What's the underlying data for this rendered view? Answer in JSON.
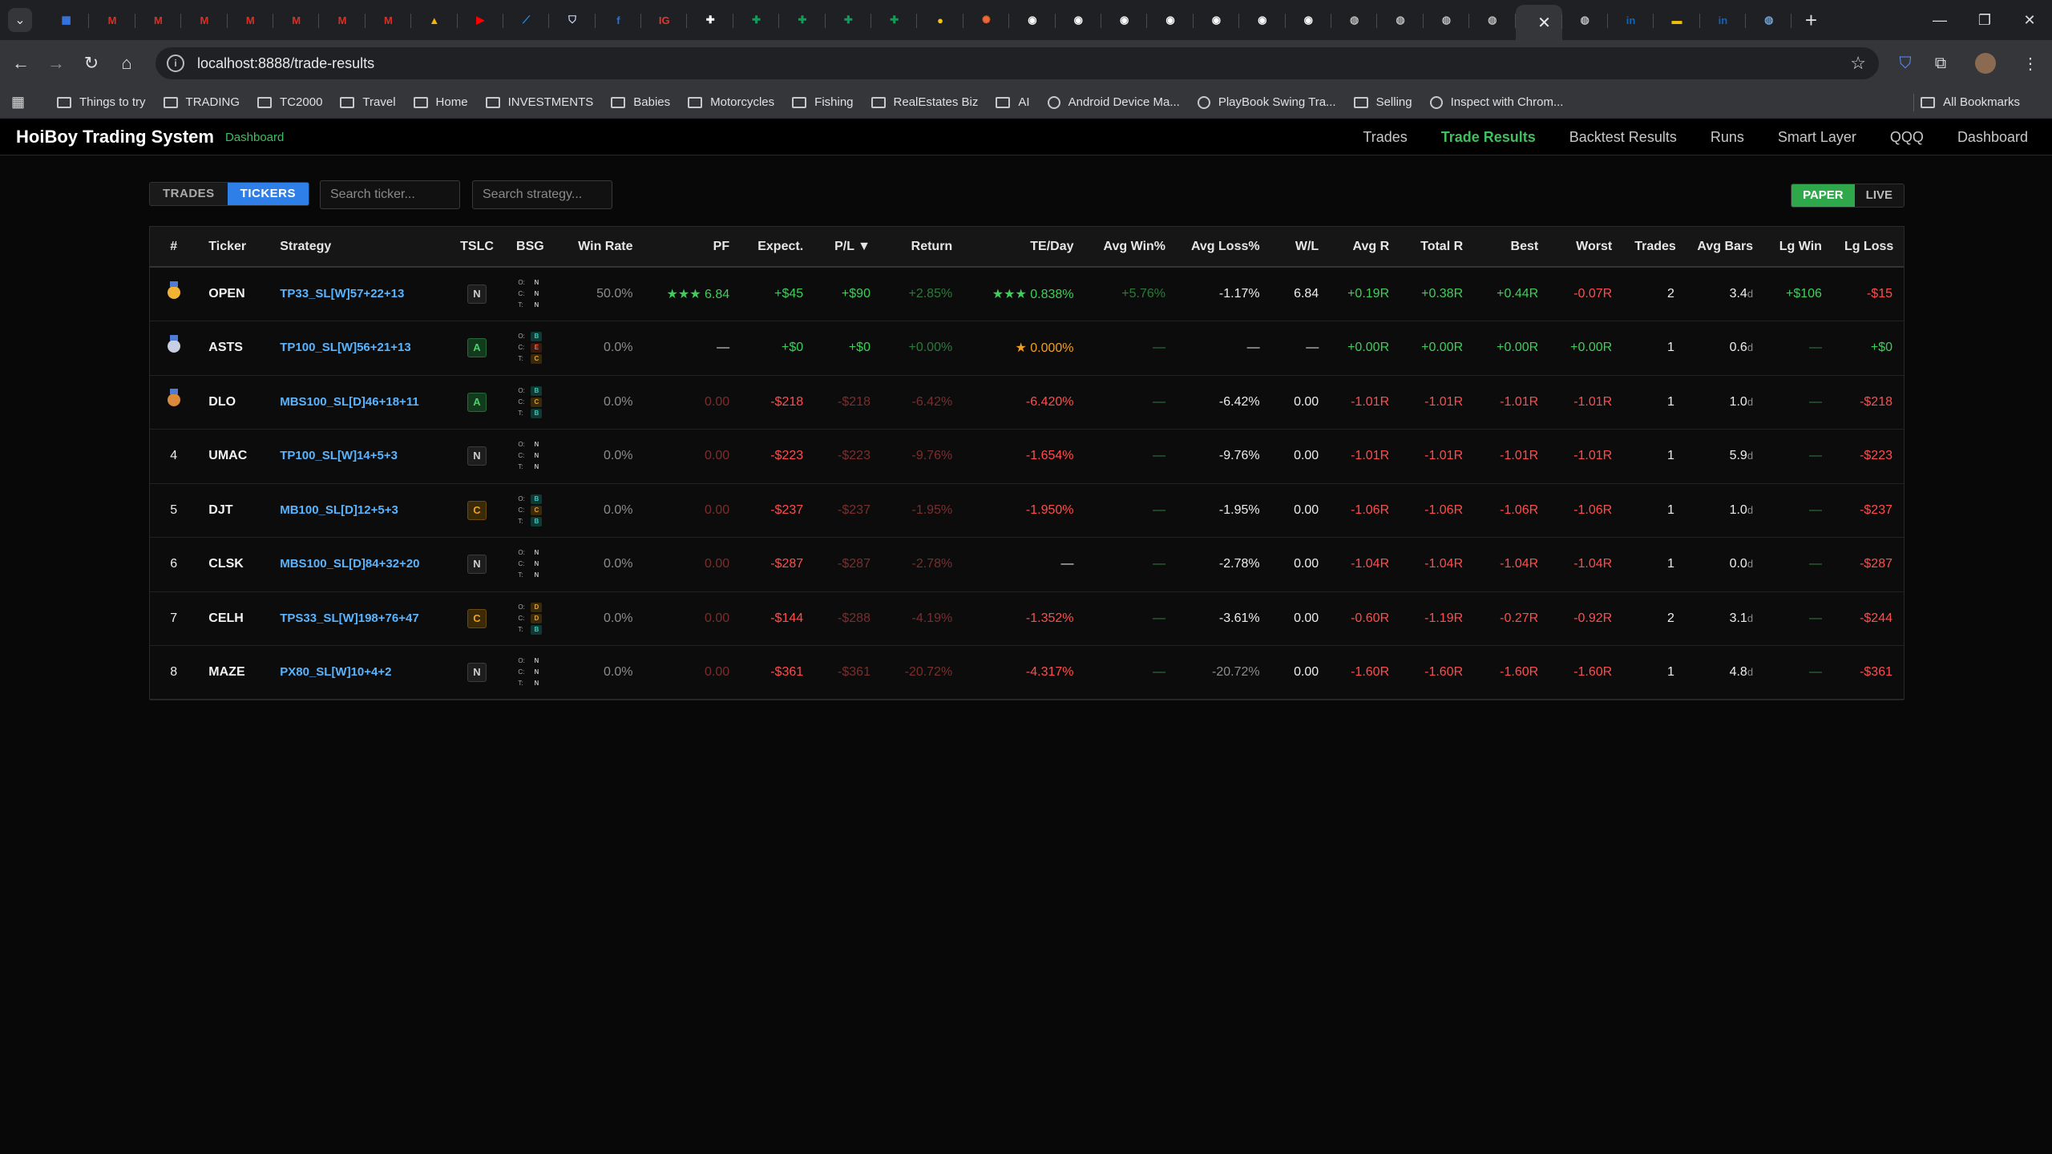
{
  "browser": {
    "url": "localhost:8888/trade-results",
    "tabs": [
      {
        "icon": "calendar-icon",
        "color": "#3b7be8",
        "glyph": "▦"
      },
      {
        "icon": "gmail-icon",
        "color": "#d93025",
        "glyph": "M"
      },
      {
        "icon": "gmail-icon",
        "color": "#d93025",
        "glyph": "M"
      },
      {
        "icon": "gmail-icon",
        "color": "#d93025",
        "glyph": "M"
      },
      {
        "icon": "gmail-icon",
        "color": "#d93025",
        "glyph": "M"
      },
      {
        "icon": "gmail-icon",
        "color": "#d93025",
        "glyph": "M"
      },
      {
        "icon": "gmail-icon",
        "color": "#d93025",
        "glyph": "M"
      },
      {
        "icon": "gmail-icon",
        "color": "#d93025",
        "glyph": "M"
      },
      {
        "icon": "drive-icon",
        "color": "#f4b400",
        "glyph": "▲"
      },
      {
        "icon": "youtube-icon",
        "color": "#ff0000",
        "glyph": "▶"
      },
      {
        "icon": "chart-app-icon",
        "color": "#2a8ce8",
        "glyph": "⟋"
      },
      {
        "icon": "shield-icon",
        "color": "#cfd8ff",
        "glyph": "⛉"
      },
      {
        "icon": "facebook-icon",
        "color": "#1877f2",
        "glyph": "f"
      },
      {
        "icon": "ig-app-icon",
        "color": "#e4382c",
        "glyph": "IG"
      },
      {
        "icon": "plus-square-icon",
        "color": "#ffffff",
        "glyph": "✚"
      },
      {
        "icon": "sheets-icon",
        "color": "#0f9d58",
        "glyph": "✚"
      },
      {
        "icon": "sheets-icon",
        "color": "#0f9d58",
        "glyph": "✚"
      },
      {
        "icon": "sheets-icon",
        "color": "#0f9d58",
        "glyph": "✚"
      },
      {
        "icon": "sheets-icon",
        "color": "#0f9d58",
        "glyph": "✚"
      },
      {
        "icon": "coin-icon",
        "color": "#f5c518",
        "glyph": "●"
      },
      {
        "icon": "spark-icon",
        "color": "#e86a3a",
        "glyph": "✺"
      },
      {
        "icon": "github-icon",
        "color": "#ffffff",
        "glyph": "◉"
      },
      {
        "icon": "github-icon",
        "color": "#ffffff",
        "glyph": "◉"
      },
      {
        "icon": "github-icon",
        "color": "#ffffff",
        "glyph": "◉"
      },
      {
        "icon": "github-icon",
        "color": "#ffffff",
        "glyph": "◉"
      },
      {
        "icon": "github-icon",
        "color": "#ffffff",
        "glyph": "◉"
      },
      {
        "icon": "github-icon",
        "color": "#ffffff",
        "glyph": "◉"
      },
      {
        "icon": "github-icon",
        "color": "#ffffff",
        "glyph": "◉"
      },
      {
        "icon": "globe-icon",
        "color": "#bbbbbb",
        "glyph": "◍"
      },
      {
        "icon": "globe-icon",
        "color": "#bbbbbb",
        "glyph": "◍"
      },
      {
        "icon": "globe-icon",
        "color": "#bbbbbb",
        "glyph": "◍"
      },
      {
        "icon": "globe-icon",
        "color": "#bbbbbb",
        "glyph": "◍"
      },
      {
        "icon": "active-tab",
        "color": "#ffffff",
        "glyph": ""
      },
      {
        "icon": "globe-icon",
        "color": "#bbbbbb",
        "glyph": "◍"
      },
      {
        "icon": "linkedin-icon",
        "color": "#0a66c2",
        "glyph": "in"
      },
      {
        "icon": "flag-icon",
        "color": "#f0c000",
        "glyph": "▬"
      },
      {
        "icon": "linkedin-icon",
        "color": "#0a66c2",
        "glyph": "in"
      },
      {
        "icon": "earth-icon",
        "color": "#6aa0d8",
        "glyph": "◍"
      }
    ],
    "bookmarks": [
      {
        "label": "Things to try",
        "type": "folder"
      },
      {
        "label": "TRADING",
        "type": "folder"
      },
      {
        "label": "TC2000",
        "type": "folder"
      },
      {
        "label": "Travel",
        "type": "folder"
      },
      {
        "label": "Home",
        "type": "folder"
      },
      {
        "label": "INVESTMENTS",
        "type": "folder"
      },
      {
        "label": "Babies",
        "type": "folder"
      },
      {
        "label": "Motorcycles",
        "type": "folder"
      },
      {
        "label": "Fishing",
        "type": "folder"
      },
      {
        "label": "RealEstates Biz",
        "type": "folder"
      },
      {
        "label": "AI",
        "type": "folder"
      },
      {
        "label": "Android Device Ma...",
        "type": "link"
      },
      {
        "label": "PlayBook Swing Tra...",
        "type": "link"
      },
      {
        "label": "Selling",
        "type": "folder"
      },
      {
        "label": "Inspect with Chrom...",
        "type": "link"
      }
    ],
    "all_bookmarks": "All Bookmarks"
  },
  "app": {
    "brand": "HoiBoy Trading System",
    "brand_sub": "Dashboard",
    "nav": [
      "Trades",
      "Trade Results",
      "Backtest Results",
      "Runs",
      "Smart Layer",
      "QQQ",
      "Dashboard"
    ],
    "nav_active": "Trade Results"
  },
  "controls": {
    "view_trades": "TRADES",
    "view_tickers": "TICKERS",
    "search_ticker_placeholder": "Search ticker...",
    "search_strategy_placeholder": "Search strategy...",
    "mode_paper": "PAPER",
    "mode_live": "LIVE"
  },
  "table": {
    "columns": [
      "#",
      "Ticker",
      "Strategy",
      "TSLC",
      "BSG",
      "Win Rate",
      "PF",
      "Expect.",
      "P/L ▼",
      "Return",
      "TE/Day",
      "Avg Win%",
      "Avg Loss%",
      "W/L",
      "Avg R",
      "Total R",
      "Best",
      "Worst",
      "Trades",
      "Avg Bars",
      "Lg Win",
      "Lg Loss"
    ],
    "bsg_keys": [
      "O:",
      "C:",
      "T:"
    ],
    "rows": [
      {
        "rank": "",
        "medal": "gold",
        "ticker": "OPEN",
        "strategy": "TP33_SL[W]57+22+13",
        "tslc": "N",
        "bsg": [
          "N",
          "N",
          "N"
        ],
        "win_rate": "50.0%",
        "pf": "★★★ 6.84",
        "expect": "+$45",
        "pl": "+$90",
        "ret": "+2.85%",
        "te_day": "★★★ 0.838%",
        "avg_win": "+5.76%",
        "avg_loss": "-1.17%",
        "wl": "6.84",
        "avg_r": "+0.19R",
        "total_r": "+0.38R",
        "best": "+0.44R",
        "worst": "-0.07R",
        "trades": "2",
        "avg_bars": "3.4",
        "lg_win": "+$106",
        "lg_loss": "-$15"
      },
      {
        "rank": "",
        "medal": "silver",
        "ticker": "ASTS",
        "strategy": "TP100_SL[W]56+21+13",
        "tslc": "A",
        "bsg": [
          "B",
          "E",
          "C"
        ],
        "win_rate": "0.0%",
        "pf": "—",
        "expect": "+$0",
        "pl": "+$0",
        "ret": "+0.00%",
        "te_day": "★ 0.000%",
        "avg_win": "—",
        "avg_loss": "—",
        "wl": "—",
        "avg_r": "+0.00R",
        "total_r": "+0.00R",
        "best": "+0.00R",
        "worst": "+0.00R",
        "trades": "1",
        "avg_bars": "0.6",
        "lg_win": "—",
        "lg_loss": "+$0"
      },
      {
        "rank": "",
        "medal": "bronze",
        "ticker": "DLO",
        "strategy": "MBS100_SL[D]46+18+11",
        "tslc": "A",
        "bsg": [
          "B",
          "C",
          "B"
        ],
        "win_rate": "0.0%",
        "pf": "0.00",
        "expect": "-$218",
        "pl": "-$218",
        "ret": "-6.42%",
        "te_day": "-6.420%",
        "avg_win": "—",
        "avg_loss": "-6.42%",
        "wl": "0.00",
        "avg_r": "-1.01R",
        "total_r": "-1.01R",
        "best": "-1.01R",
        "worst": "-1.01R",
        "trades": "1",
        "avg_bars": "1.0",
        "lg_win": "—",
        "lg_loss": "-$218"
      },
      {
        "rank": "4",
        "medal": "",
        "ticker": "UMAC",
        "strategy": "TP100_SL[W]14+5+3",
        "tslc": "N",
        "bsg": [
          "N",
          "N",
          "N"
        ],
        "win_rate": "0.0%",
        "pf": "0.00",
        "expect": "-$223",
        "pl": "-$223",
        "ret": "-9.76%",
        "te_day": "-1.654%",
        "avg_win": "—",
        "avg_loss": "-9.76%",
        "wl": "0.00",
        "avg_r": "-1.01R",
        "total_r": "-1.01R",
        "best": "-1.01R",
        "worst": "-1.01R",
        "trades": "1",
        "avg_bars": "5.9",
        "lg_win": "—",
        "lg_loss": "-$223"
      },
      {
        "rank": "5",
        "medal": "",
        "ticker": "DJT",
        "strategy": "MB100_SL[D]12+5+3",
        "tslc": "C",
        "bsg": [
          "B",
          "C",
          "B"
        ],
        "win_rate": "0.0%",
        "pf": "0.00",
        "expect": "-$237",
        "pl": "-$237",
        "ret": "-1.95%",
        "te_day": "-1.950%",
        "avg_win": "—",
        "avg_loss": "-1.95%",
        "wl": "0.00",
        "avg_r": "-1.06R",
        "total_r": "-1.06R",
        "best": "-1.06R",
        "worst": "-1.06R",
        "trades": "1",
        "avg_bars": "1.0",
        "lg_win": "—",
        "lg_loss": "-$237"
      },
      {
        "rank": "6",
        "medal": "",
        "ticker": "CLSK",
        "strategy": "MBS100_SL[D]84+32+20",
        "tslc": "N",
        "bsg": [
          "N",
          "N",
          "N"
        ],
        "win_rate": "0.0%",
        "pf": "0.00",
        "expect": "-$287",
        "pl": "-$287",
        "ret": "-2.78%",
        "te_day": "—",
        "avg_win": "—",
        "avg_loss": "-2.78%",
        "wl": "0.00",
        "avg_r": "-1.04R",
        "total_r": "-1.04R",
        "best": "-1.04R",
        "worst": "-1.04R",
        "trades": "1",
        "avg_bars": "0.0",
        "lg_win": "—",
        "lg_loss": "-$287"
      },
      {
        "rank": "7",
        "medal": "",
        "ticker": "CELH",
        "strategy": "TPS33_SL[W]198+76+47",
        "tslc": "C",
        "bsg": [
          "D",
          "D",
          "B"
        ],
        "win_rate": "0.0%",
        "pf": "0.00",
        "expect": "-$144",
        "pl": "-$288",
        "ret": "-4.19%",
        "te_day": "-1.352%",
        "avg_win": "—",
        "avg_loss": "-3.61%",
        "wl": "0.00",
        "avg_r": "-0.60R",
        "total_r": "-1.19R",
        "best": "-0.27R",
        "worst": "-0.92R",
        "trades": "2",
        "avg_bars": "3.1",
        "lg_win": "—",
        "lg_loss": "-$244"
      },
      {
        "rank": "8",
        "medal": "",
        "ticker": "MAZE",
        "strategy": "PX80_SL[W]10+4+2",
        "tslc": "N",
        "bsg": [
          "N",
          "N",
          "N"
        ],
        "win_rate": "0.0%",
        "pf": "0.00",
        "expect": "-$361",
        "pl": "-$361",
        "ret": "-20.72%",
        "te_day": "-4.317%",
        "avg_win": "—",
        "avg_loss": "-20.72%",
        "wl": "0.00",
        "avg_r": "-1.60R",
        "total_r": "-1.60R",
        "best": "-1.60R",
        "worst": "-1.60R",
        "trades": "1",
        "avg_bars": "4.8",
        "lg_win": "—",
        "lg_loss": "-$361"
      }
    ]
  }
}
